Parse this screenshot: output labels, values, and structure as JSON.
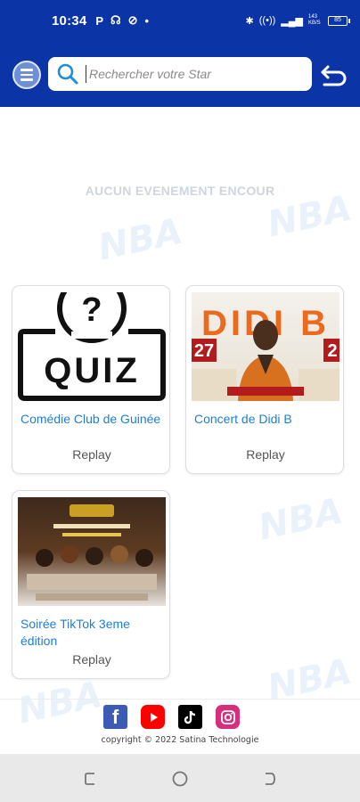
{
  "status_bar": {
    "time": "10:34",
    "left_icons": [
      "P",
      "☊",
      "⊘",
      "•"
    ],
    "right_icons": [
      "bluetooth-icon",
      "vibrate-icon",
      "lte-icon",
      "signal-icon",
      "data-speed-icon",
      "battery-icon"
    ],
    "battery_level": "85",
    "data_speed": "143 KB/S"
  },
  "header": {
    "search_placeholder": "Rechercher votre Star",
    "search_value": ""
  },
  "main": {
    "empty_message": "AUCUN EVENEMENT ENCOUR"
  },
  "events": [
    {
      "title": "Comédie Club de Guinée",
      "action": "Replay",
      "thumbnail": "quiz",
      "thumbnail_text": "QUIZ"
    },
    {
      "title": "Concert de Didi B",
      "action": "Replay",
      "thumbnail": "concert-poster",
      "thumbnail_text": "DIDI B",
      "dates": [
        "27",
        "2"
      ]
    },
    {
      "title": "Soirée TikTok 3eme édition",
      "action": "Replay",
      "thumbnail": "tiktok-party-poster"
    }
  ],
  "footer": {
    "social": [
      "facebook-icon",
      "youtube-icon",
      "tiktok-icon",
      "instagram-icon"
    ],
    "copyright": "copyright © 2022 Satina Technologie"
  },
  "colors": {
    "brand_blue": "#0b35a6",
    "title_blue": "#1f7ed2",
    "empty_text": "#cfd5df"
  }
}
